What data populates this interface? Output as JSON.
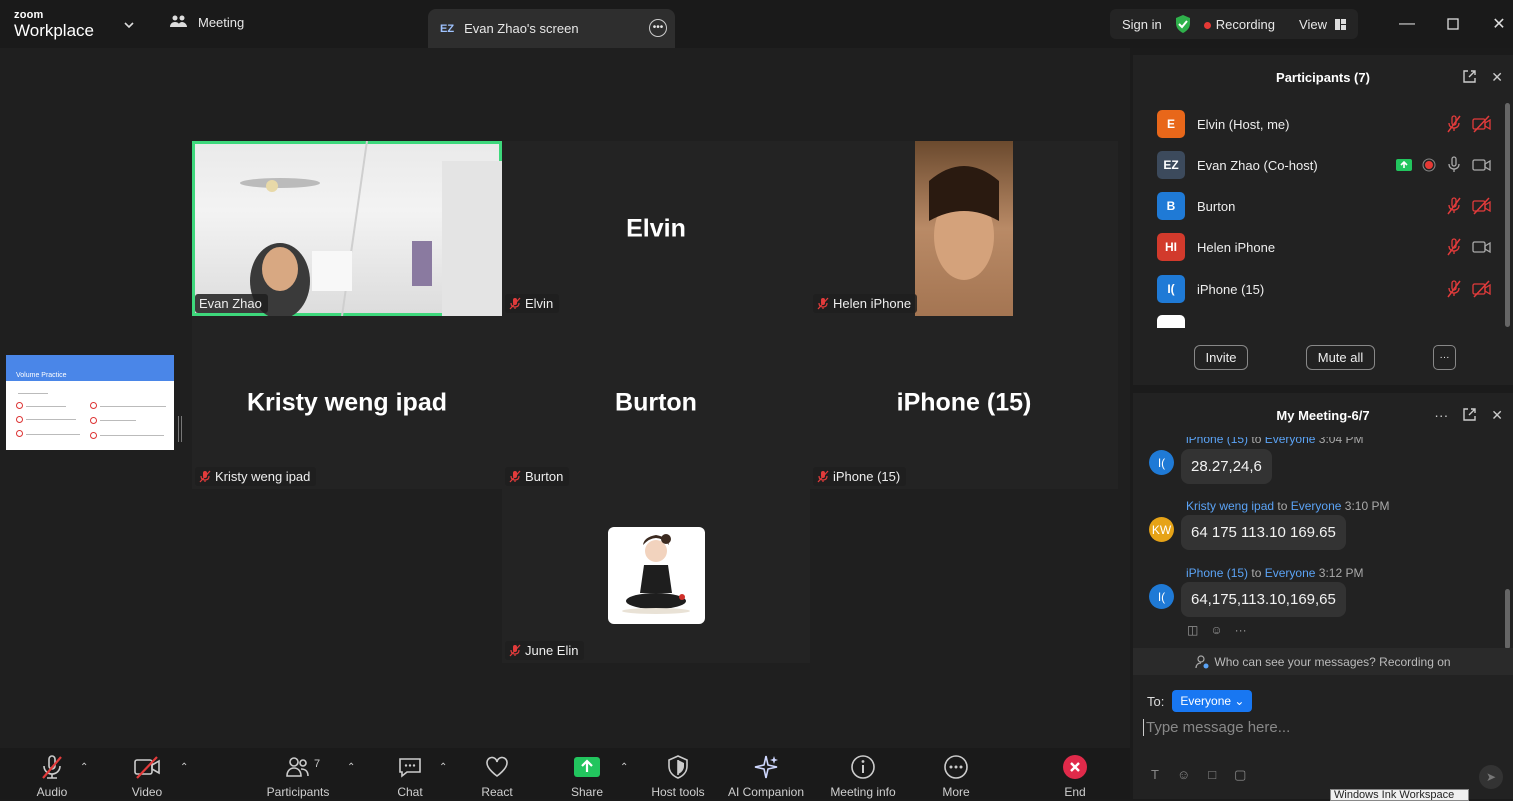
{
  "app": {
    "logo_top": "zoom",
    "logo_bottom": "Workplace",
    "meeting_label": "Meeting",
    "screen_tab_badge": "EZ",
    "screen_tab_label": "Evan Zhao's screen",
    "sign_in": "Sign in",
    "recording": "Recording",
    "view": "View"
  },
  "tiles": {
    "evan": {
      "name": "Evan Zhao"
    },
    "elvin": {
      "big": "Elvin",
      "name": "Elvin"
    },
    "helen": {
      "name": "Helen iPhone"
    },
    "kristy": {
      "big": "Kristy weng ipad",
      "name": "Kristy weng ipad"
    },
    "burton": {
      "big": "Burton",
      "name": "Burton"
    },
    "iphone": {
      "big": "iPhone (15)",
      "name": "iPhone (15)"
    },
    "june": {
      "name": "June Elin"
    }
  },
  "shared_thumb": {
    "title": "Volume Practice"
  },
  "toolbar": {
    "audio": "Audio",
    "video": "Video",
    "participants": "Participants",
    "participants_count": "7",
    "chat": "Chat",
    "react": "React",
    "share": "Share",
    "host_tools": "Host tools",
    "ai_companion": "AI Companion",
    "meeting_info": "Meeting info",
    "more": "More",
    "end": "End"
  },
  "participants_panel": {
    "title": "Participants (7)",
    "rows": [
      {
        "initials": "E",
        "name": "Elvin (Host, me)",
        "color": "#e8671a"
      },
      {
        "initials": "EZ",
        "name": "Evan Zhao (Co-host)",
        "color": "#3c4a5c"
      },
      {
        "initials": "B",
        "name": "Burton",
        "color": "#1f7ad6"
      },
      {
        "initials": "HI",
        "name": "Helen iPhone",
        "color": "#d23a2c"
      },
      {
        "initials": "I(",
        "name": "iPhone (15)",
        "color": "#1f7ad6"
      }
    ],
    "invite": "Invite",
    "mute_all": "Mute all",
    "more": "···"
  },
  "chat_panel": {
    "title": "My Meeting-6/7",
    "messages": [
      {
        "avatar": "I(",
        "sender": "iPhone (15)",
        "to": "to",
        "target": "Everyone",
        "time": "3:04 PM",
        "text": "28.27,24,6"
      },
      {
        "avatar": "KW",
        "sender": "Kristy weng ipad",
        "to": "to",
        "target": "Everyone",
        "time": "3:10 PM",
        "text": "64 175 113.10 169.65"
      },
      {
        "avatar": "I(",
        "sender": "iPhone (15)",
        "to": "to",
        "target": "Everyone",
        "time": "3:12 PM",
        "text": "64,175,113.10,169,65"
      }
    ],
    "notice": "Who can see your messages? Recording on",
    "to_label": "To:",
    "recipient": "Everyone",
    "placeholder": "Type message here..."
  },
  "os": {
    "ink_label": "Windows Ink Workspace"
  },
  "colors": {
    "accent": "#1877f2",
    "active_speaker": "#3ed87c",
    "recording": "#e53935",
    "end": "#e02a4a",
    "share": "#22c55e"
  }
}
